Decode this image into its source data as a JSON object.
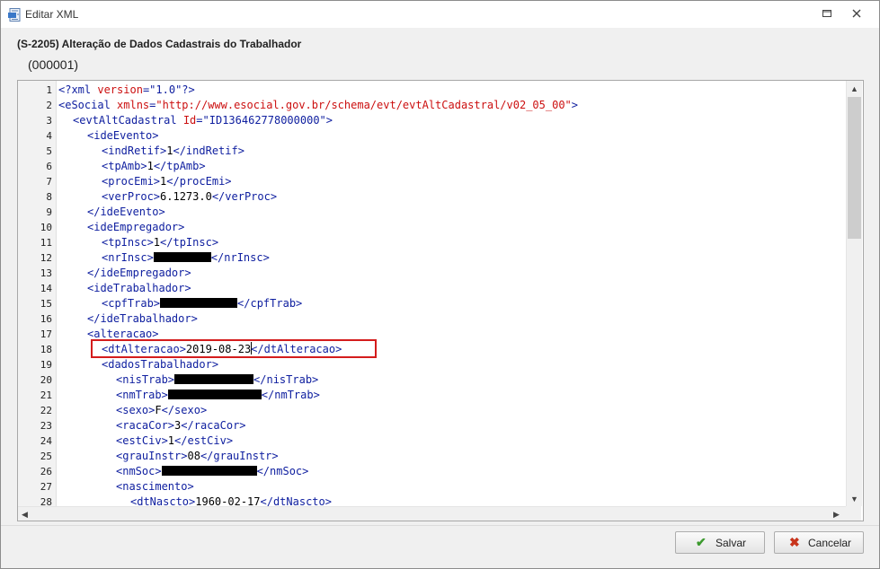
{
  "window": {
    "title": "Editar XML",
    "heading": "(S-2205) Alteração de Dados Cadastrais do Trabalhador",
    "subheading": "(000001)"
  },
  "icons": {
    "app": "xml-file-icon",
    "maximize": "maximize-icon",
    "close": "close-icon",
    "save": "checkmark-icon",
    "cancel": "cross-icon"
  },
  "colors": {
    "tag": "#1020a0",
    "attribute": "#cc1010",
    "highlight": "#d41c1c",
    "save_icon": "#3c9a2e",
    "cancel_icon": "#c8341c"
  },
  "editor": {
    "lines": [
      {
        "num": "1",
        "indent": 0,
        "segments": [
          [
            "tag",
            "<?xml"
          ],
          [
            "plain",
            " "
          ],
          [
            "attr",
            "version"
          ],
          [
            "tag",
            "="
          ],
          [
            "str",
            "\"1.0\""
          ],
          [
            "tag",
            "?>"
          ]
        ]
      },
      {
        "num": "2",
        "indent": 0,
        "segments": [
          [
            "tag",
            "<eSocial"
          ],
          [
            "plain",
            " "
          ],
          [
            "attr",
            "xmlns"
          ],
          [
            "tag",
            "="
          ],
          [
            "attr",
            "\"http://www.esocial.gov.br/schema/evt/evtAltCadastral/v02_05_00\""
          ],
          [
            "tag",
            ">"
          ]
        ]
      },
      {
        "num": "3",
        "indent": 1,
        "segments": [
          [
            "tag",
            "<evtAltCadastral"
          ],
          [
            "plain",
            " "
          ],
          [
            "attr",
            "Id"
          ],
          [
            "tag",
            "="
          ],
          [
            "str",
            "\"ID136462778000000\""
          ],
          [
            "tag",
            ">"
          ]
        ]
      },
      {
        "num": "4",
        "indent": 2,
        "segments": [
          [
            "tag",
            "<ideEvento>"
          ]
        ]
      },
      {
        "num": "5",
        "indent": 3,
        "segments": [
          [
            "tag",
            "<indRetif>"
          ],
          [
            "plain",
            "1"
          ],
          [
            "tag",
            "</indRetif>"
          ]
        ]
      },
      {
        "num": "6",
        "indent": 3,
        "segments": [
          [
            "tag",
            "<tpAmb>"
          ],
          [
            "plain",
            "1"
          ],
          [
            "tag",
            "</tpAmb>"
          ]
        ]
      },
      {
        "num": "7",
        "indent": 3,
        "segments": [
          [
            "tag",
            "<procEmi>"
          ],
          [
            "plain",
            "1"
          ],
          [
            "tag",
            "</procEmi>"
          ]
        ]
      },
      {
        "num": "8",
        "indent": 3,
        "segments": [
          [
            "tag",
            "<verProc>"
          ],
          [
            "plain",
            "6.1273.0"
          ],
          [
            "tag",
            "</verProc>"
          ]
        ]
      },
      {
        "num": "9",
        "indent": 2,
        "segments": [
          [
            "tag",
            "</ideEvento>"
          ]
        ]
      },
      {
        "num": "10",
        "indent": 2,
        "segments": [
          [
            "tag",
            "<ideEmpregador>"
          ]
        ]
      },
      {
        "num": "11",
        "indent": 3,
        "segments": [
          [
            "tag",
            "<tpInsc>"
          ],
          [
            "plain",
            "1"
          ],
          [
            "tag",
            "</tpInsc>"
          ]
        ]
      },
      {
        "num": "12",
        "indent": 3,
        "segments": [
          [
            "tag",
            "<nrInsc>"
          ],
          [
            "redact",
            "64"
          ],
          [
            "tag",
            "</nrInsc>"
          ]
        ]
      },
      {
        "num": "13",
        "indent": 2,
        "segments": [
          [
            "tag",
            "</ideEmpregador>"
          ]
        ]
      },
      {
        "num": "14",
        "indent": 2,
        "segments": [
          [
            "tag",
            "<ideTrabalhador>"
          ]
        ]
      },
      {
        "num": "15",
        "indent": 3,
        "segments": [
          [
            "tag",
            "<cpfTrab>"
          ],
          [
            "redact",
            "86"
          ],
          [
            "tag",
            "</cpfTrab>"
          ]
        ]
      },
      {
        "num": "16",
        "indent": 2,
        "segments": [
          [
            "tag",
            "</ideTrabalhador>"
          ]
        ]
      },
      {
        "num": "17",
        "indent": 2,
        "segments": [
          [
            "tag",
            "<alteracao>"
          ]
        ]
      },
      {
        "num": "18",
        "indent": 3,
        "segments": [
          [
            "tag",
            "<dtAlteracao>"
          ],
          [
            "plain",
            "2019-08-23"
          ],
          [
            "caret",
            ""
          ],
          [
            "tag",
            "</dtAlteracao>"
          ]
        ]
      },
      {
        "num": "19",
        "indent": 3,
        "segments": [
          [
            "tag",
            "<dadosTrabalhador>"
          ]
        ]
      },
      {
        "num": "20",
        "indent": 4,
        "segments": [
          [
            "tag",
            "<nisTrab>"
          ],
          [
            "redact",
            "88"
          ],
          [
            "tag",
            "</nisTrab>"
          ]
        ]
      },
      {
        "num": "21",
        "indent": 4,
        "segments": [
          [
            "tag",
            "<nmTrab>"
          ],
          [
            "redact",
            "104"
          ],
          [
            "tag",
            "</nmTrab>"
          ]
        ]
      },
      {
        "num": "22",
        "indent": 4,
        "segments": [
          [
            "tag",
            "<sexo>"
          ],
          [
            "plain",
            "F"
          ],
          [
            "tag",
            "</sexo>"
          ]
        ]
      },
      {
        "num": "23",
        "indent": 4,
        "segments": [
          [
            "tag",
            "<racaCor>"
          ],
          [
            "plain",
            "3"
          ],
          [
            "tag",
            "</racaCor>"
          ]
        ]
      },
      {
        "num": "24",
        "indent": 4,
        "segments": [
          [
            "tag",
            "<estCiv>"
          ],
          [
            "plain",
            "1"
          ],
          [
            "tag",
            "</estCiv>"
          ]
        ]
      },
      {
        "num": "25",
        "indent": 4,
        "segments": [
          [
            "tag",
            "<grauInstr>"
          ],
          [
            "plain",
            "08"
          ],
          [
            "tag",
            "</grauInstr>"
          ]
        ]
      },
      {
        "num": "26",
        "indent": 4,
        "segments": [
          [
            "tag",
            "<nmSoc>"
          ],
          [
            "redact",
            "106"
          ],
          [
            "tag",
            "</nmSoc>"
          ]
        ]
      },
      {
        "num": "27",
        "indent": 4,
        "segments": [
          [
            "tag",
            "<nascimento>"
          ]
        ]
      },
      {
        "num": "28",
        "indent": 5,
        "segments": [
          [
            "tag",
            "<dtNascto>"
          ],
          [
            "plain",
            "1960-02-17"
          ],
          [
            "tag",
            "</dtNascto>"
          ]
        ]
      }
    ]
  },
  "buttons": {
    "save": "Salvar",
    "cancel": "Cancelar"
  }
}
